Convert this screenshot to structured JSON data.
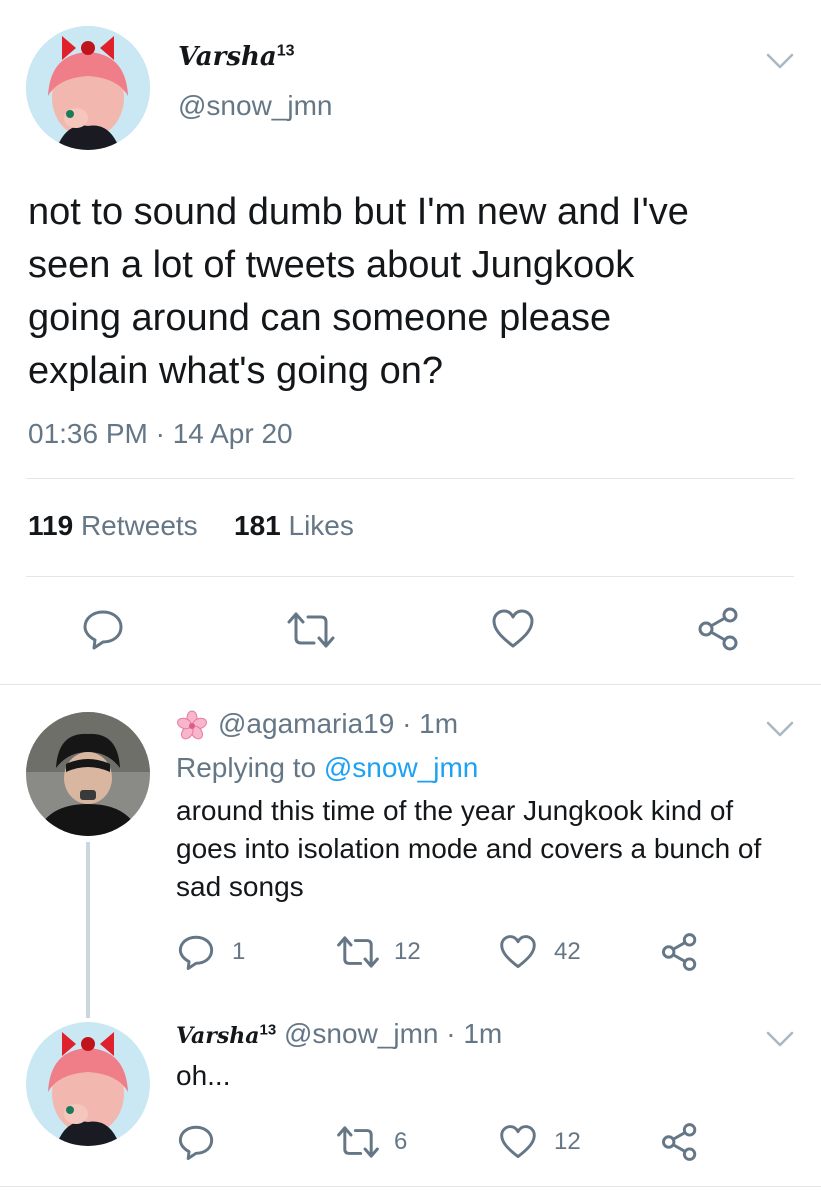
{
  "main_tweet": {
    "display_name": "Varsha",
    "display_name_sup": "13",
    "handle": "@snow_jmn",
    "text_lines": [
      "not to sound dumb but I'm new and I've",
      "seen a lot of tweets about Jungkook",
      "going around can someone please",
      "explain what's going on?"
    ],
    "timestamp": "01:36 PM · 14 Apr 20",
    "retweets_count": "119",
    "retweets_label": "Retweets",
    "likes_count": "181",
    "likes_label": "Likes"
  },
  "reply_1": {
    "emoji_name": "cherry-blossom-icon",
    "handle_time": "@agamaria19 · 1m",
    "replying_prefix": "Replying to",
    "replying_handle": "@snow_jmn",
    "text_lines": [
      "around this time of the year Jungkook kind of",
      "goes into isolation mode and covers a bunch of",
      "sad songs"
    ],
    "reply_count": "1",
    "retweet_count": "12",
    "like_count": "42"
  },
  "reply_2": {
    "display_name": "Varsha",
    "display_name_sup": "13",
    "handle_time": "@snow_jmn · 1m",
    "text": "oh...",
    "retweet_count": "6",
    "like_count": "12"
  },
  "colors": {
    "text": "#14171a",
    "muted": "#657786",
    "link": "#1da1f2",
    "divider": "#e1e8ed",
    "thread_line": "#ccd6dd"
  }
}
